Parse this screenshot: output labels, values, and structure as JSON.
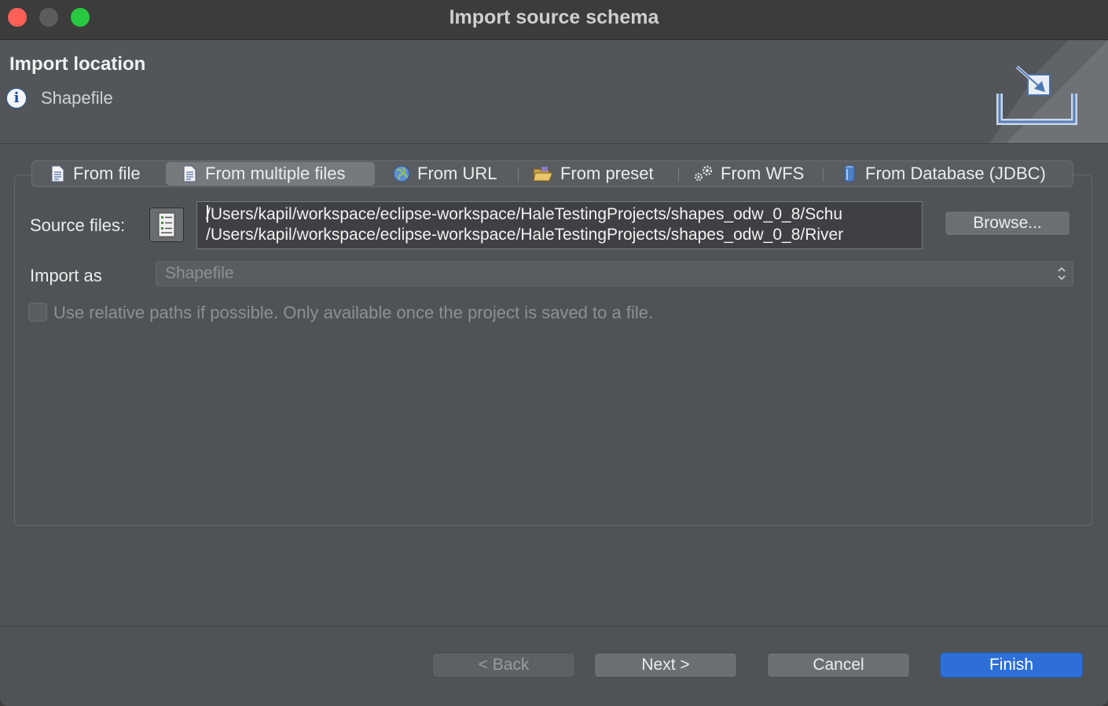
{
  "window": {
    "title": "Import source schema"
  },
  "header": {
    "title": "Import location",
    "subtitle": "Shapefile",
    "info_icon": "info-icon",
    "banner_icon": "import-tray-icon"
  },
  "tabs": [
    {
      "label": "From file",
      "icon": "document-icon",
      "active": false
    },
    {
      "label": "From multiple files",
      "icon": "documents-icon",
      "active": true
    },
    {
      "label": "From URL",
      "icon": "globe-icon",
      "active": false
    },
    {
      "label": "From preset",
      "icon": "folder-open-icon",
      "active": false
    },
    {
      "label": "From WFS",
      "icon": "gears-icon",
      "active": false
    },
    {
      "label": "From Database (JDBC)",
      "icon": "database-icon",
      "active": false
    }
  ],
  "form": {
    "source_files_label": "Source files:",
    "source_files": [
      "/Users/kapil/workspace/eclipse-workspace/HaleTestingProjects/shapes_odw_0_8/Schu",
      "/Users/kapil/workspace/eclipse-workspace/HaleTestingProjects/shapes_odw_0_8/River"
    ],
    "browse_label": "Browse...",
    "import_as_label": "Import as",
    "import_as_value": "Shapefile",
    "relative_paths_label": "Use relative paths if possible. Only available once the project is saved to a file.",
    "relative_paths_checked": false
  },
  "footer": {
    "back_label": "< Back",
    "next_label": "Next >",
    "cancel_label": "Cancel",
    "finish_label": "Finish"
  },
  "colors": {
    "accent": "#2d6fd6",
    "close": "#fe5f57",
    "maximize": "#28c840"
  }
}
